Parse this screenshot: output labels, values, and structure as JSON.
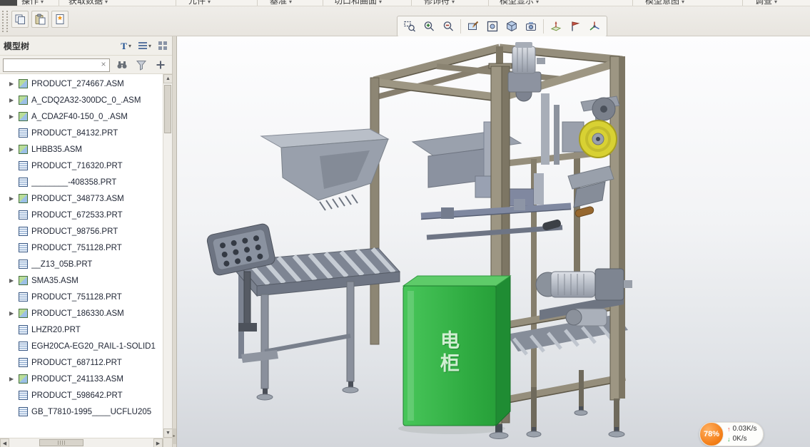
{
  "ribbon": {
    "groups": [
      "操作",
      "获取数据",
      "元件",
      "基准",
      "切口和曲面",
      "修饰符",
      "模型显示",
      "模型意图",
      "调查"
    ]
  },
  "quickbar": {
    "icons": [
      "duplicate",
      "clipboard-paste",
      "favorite-document"
    ]
  },
  "graphics_toolbar": {
    "icons": [
      "zoom-box",
      "zoom-in",
      "zoom-out",
      "repaint",
      "refit",
      "display-style",
      "saved-orientations",
      "datum-display",
      "annotation-display",
      "spin-center"
    ]
  },
  "model_tree": {
    "title": "模型树",
    "search_value": "",
    "clear_glyph": "×",
    "header_icons": [
      "tree-filter",
      "tree-display-options",
      "tree-settings"
    ],
    "search_icons": [
      "find-in-tree",
      "tree-filters",
      "add-column"
    ],
    "items": [
      {
        "label": "PRODUCT_274667.ASM",
        "type": "asm",
        "expandable": true
      },
      {
        "label": "A_CDQ2A32-300DC_0_.ASM",
        "type": "asm",
        "expandable": true
      },
      {
        "label": "A_CDA2F40-150_0_.ASM",
        "type": "asm",
        "expandable": true
      },
      {
        "label": "PRODUCT_84132.PRT",
        "type": "prt",
        "expandable": false
      },
      {
        "label": "LHBB35.ASM",
        "type": "asm",
        "expandable": true
      },
      {
        "label": "PRODUCT_716320.PRT",
        "type": "prt",
        "expandable": false
      },
      {
        "label": "________-408358.PRT",
        "type": "prt",
        "expandable": false
      },
      {
        "label": "PRODUCT_348773.ASM",
        "type": "asm",
        "expandable": true
      },
      {
        "label": "PRODUCT_672533.PRT",
        "type": "prt",
        "expandable": false
      },
      {
        "label": "PRODUCT_98756.PRT",
        "type": "prt",
        "expandable": false
      },
      {
        "label": "PRODUCT_751128.PRT",
        "type": "prt",
        "expandable": false
      },
      {
        "label": "__Z13_05B.PRT",
        "type": "prt",
        "expandable": false
      },
      {
        "label": "SMA35.ASM",
        "type": "asm",
        "expandable": true
      },
      {
        "label": "PRODUCT_751128.PRT",
        "type": "prt",
        "expandable": false
      },
      {
        "label": "PRODUCT_186330.ASM",
        "type": "asm",
        "expandable": true
      },
      {
        "label": "LHZR20.PRT",
        "type": "prt",
        "expandable": false
      },
      {
        "label": "EGH20CA-EG20_RAIL-1-SOLID1",
        "type": "prt",
        "expandable": false
      },
      {
        "label": "PRODUCT_687112.PRT",
        "type": "prt",
        "expandable": false
      },
      {
        "label": "PRODUCT_241133.ASM",
        "type": "asm",
        "expandable": true
      },
      {
        "label": "PRODUCT_598642.PRT",
        "type": "prt",
        "expandable": false
      },
      {
        "label": "GB_T7810-1995____UCFLU205",
        "type": "prt",
        "expandable": false
      }
    ]
  },
  "viewport": {
    "cabinet_label": "电柜"
  },
  "overlay": {
    "percent": "78%",
    "up_speed": "0.03K/s",
    "down_speed": "0K/s",
    "icons": [
      "up-arrow",
      "down-arrow"
    ]
  },
  "colors": {
    "cabinet_green": "#35b24a",
    "tape_yellow": "#d8d133",
    "frame_tan": "#958e7c",
    "badge_orange": "#f5831f"
  }
}
